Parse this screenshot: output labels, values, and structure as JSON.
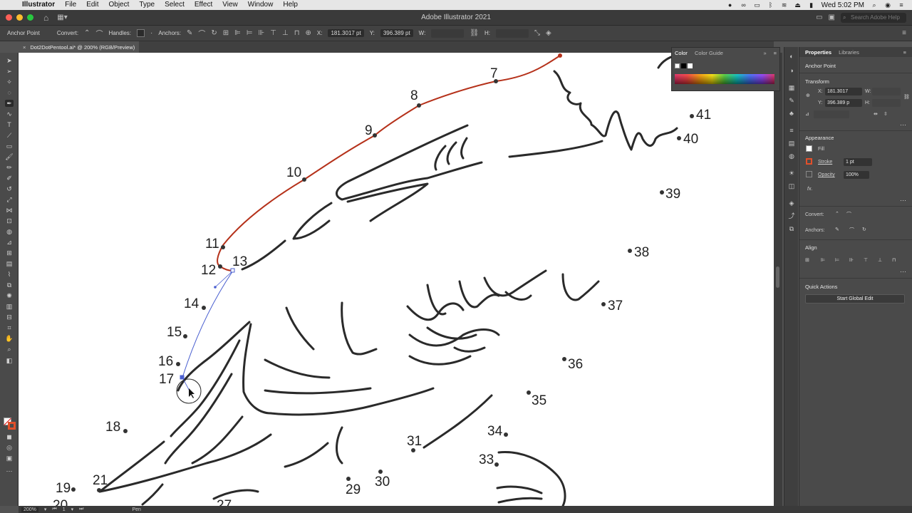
{
  "menubar": {
    "app": "Illustrator",
    "items": [
      "File",
      "Edit",
      "Object",
      "Type",
      "Select",
      "Effect",
      "View",
      "Window",
      "Help"
    ],
    "clock": "Wed 5:02 PM"
  },
  "titlebar": {
    "title": "Adobe Illustrator 2021",
    "search_placeholder": "Search Adobe Help"
  },
  "control_bar": {
    "mode": "Anchor Point",
    "convert_label": "Convert:",
    "handles_label": "Handles:",
    "anchors_label": "Anchors:",
    "x_label": "X:",
    "x_value": "181.3017 pt",
    "y_label": "Y:",
    "y_value": "396.389 pt",
    "w_label": "W:",
    "h_label": "H:"
  },
  "document_tab": {
    "label": "Dot2DotPentool.ai* @ 200% (RGB/Preview)"
  },
  "artwork": {
    "dot_numbers": [
      "7",
      "8",
      "9",
      "10",
      "11",
      "12",
      "13",
      "14",
      "15",
      "16",
      "17",
      "18",
      "19",
      "20",
      "21",
      "27",
      "29",
      "30",
      "31",
      "33",
      "34",
      "35",
      "36",
      "37",
      "38",
      "39",
      "40",
      "41"
    ]
  },
  "color_panel": {
    "tab_color": "Color",
    "tab_guide": "Color Guide"
  },
  "properties": {
    "tab_properties": "Properties",
    "tab_libraries": "Libraries",
    "selection": "Anchor Point",
    "transform_header": "Transform",
    "x_label": "X:",
    "x_value": "181.3017",
    "y_label": "Y:",
    "y_value": "396.389 p",
    "w_label": "W:",
    "h_label": "H:",
    "appearance_header": "Appearance",
    "fill_label": "Fill",
    "stroke_label": "Stroke",
    "stroke_value": "1 pt",
    "opacity_label": "Opacity",
    "opacity_value": "100%",
    "fx_label": "fx.",
    "convert_label": "Convert:",
    "anchors_label": "Anchors:",
    "align_header": "Align",
    "quick_actions_header": "Quick Actions",
    "global_edit_button": "Start Global Edit"
  },
  "statusbar": {
    "zoom": "200%",
    "artboard": "1",
    "tool": "Pen"
  },
  "colors": {
    "path_red": "#b5311a",
    "handle_blue": "#4a5fd0",
    "accent": "#2b6bd6"
  }
}
